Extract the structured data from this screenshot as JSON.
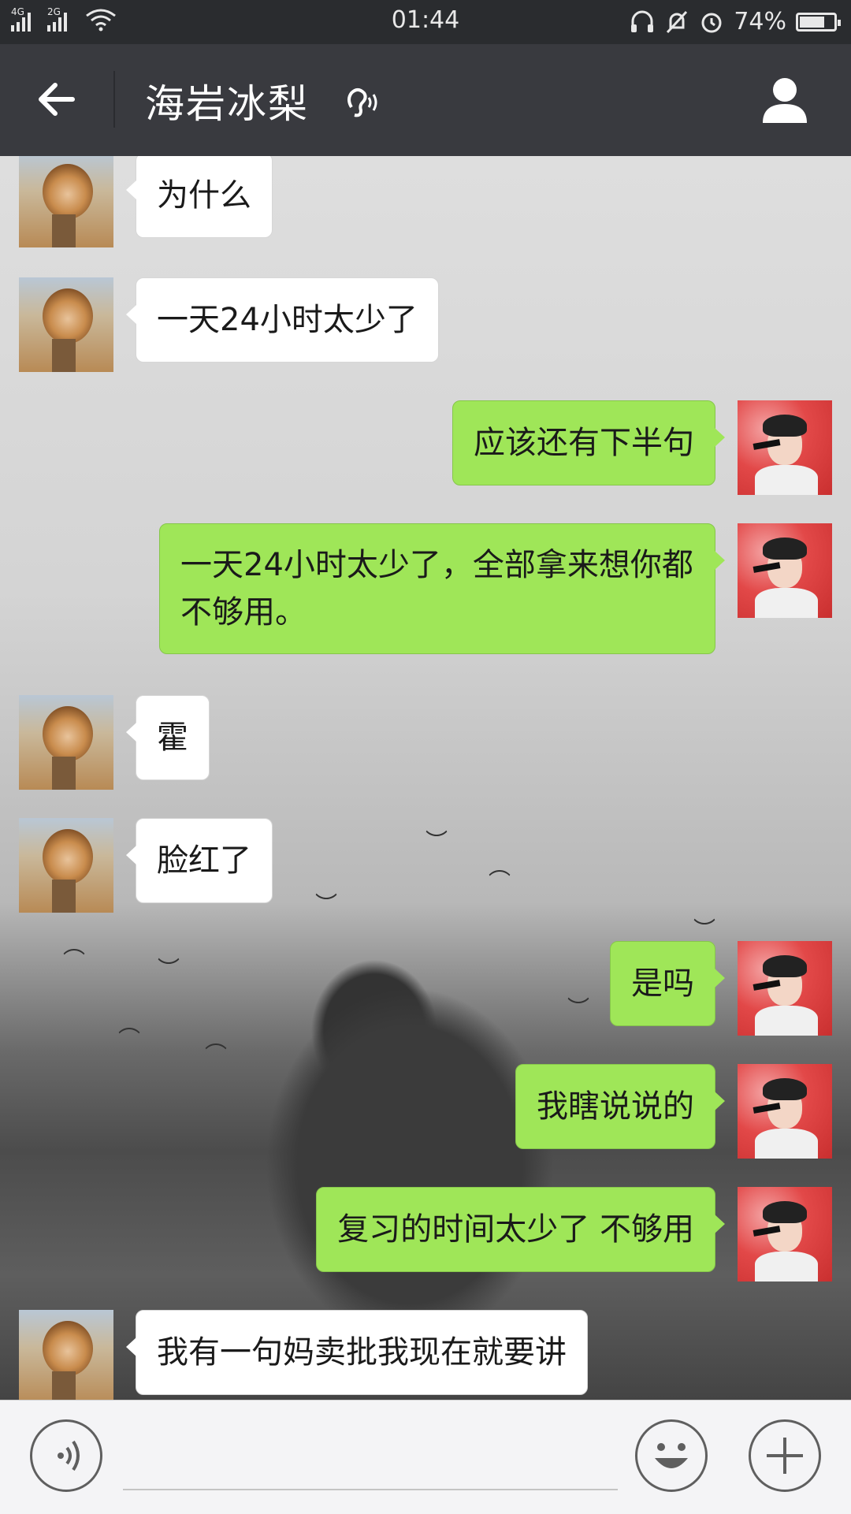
{
  "status_bar": {
    "network_1": "4G",
    "network_2": "2G",
    "time": "01:44",
    "battery_percent": "74%",
    "battery_level": 0.74
  },
  "header": {
    "title": "海岩冰梨",
    "back_icon": "arrow-left-icon",
    "earpiece_icon": "ear-icon",
    "contact_icon": "person-icon"
  },
  "messages": [
    {
      "side": "in",
      "text": "为什么"
    },
    {
      "side": "in",
      "text": "一天24小时太少了"
    },
    {
      "side": "out",
      "text": "应该还有下半句"
    },
    {
      "side": "out",
      "text": "一天24小时太少了，全部拿来想你都不够用。"
    },
    {
      "side": "in",
      "text": "霍"
    },
    {
      "side": "in",
      "text": "脸红了"
    },
    {
      "side": "out",
      "text": "是吗"
    },
    {
      "side": "out",
      "text": "我瞎说说的"
    },
    {
      "side": "out",
      "text": "复习的时间太少了 不够用"
    },
    {
      "side": "in",
      "text": "我有一句妈卖批我现在就要讲"
    }
  ],
  "input_bar": {
    "voice_icon": "voice-icon",
    "emoji_icon": "smiley-icon",
    "more_icon": "plus-icon",
    "placeholder": ""
  },
  "colors": {
    "header_bg": "#393a3f",
    "status_bg": "#2a2c2f",
    "outgoing_bubble": "#9fe658",
    "incoming_bubble": "#ffffff"
  }
}
